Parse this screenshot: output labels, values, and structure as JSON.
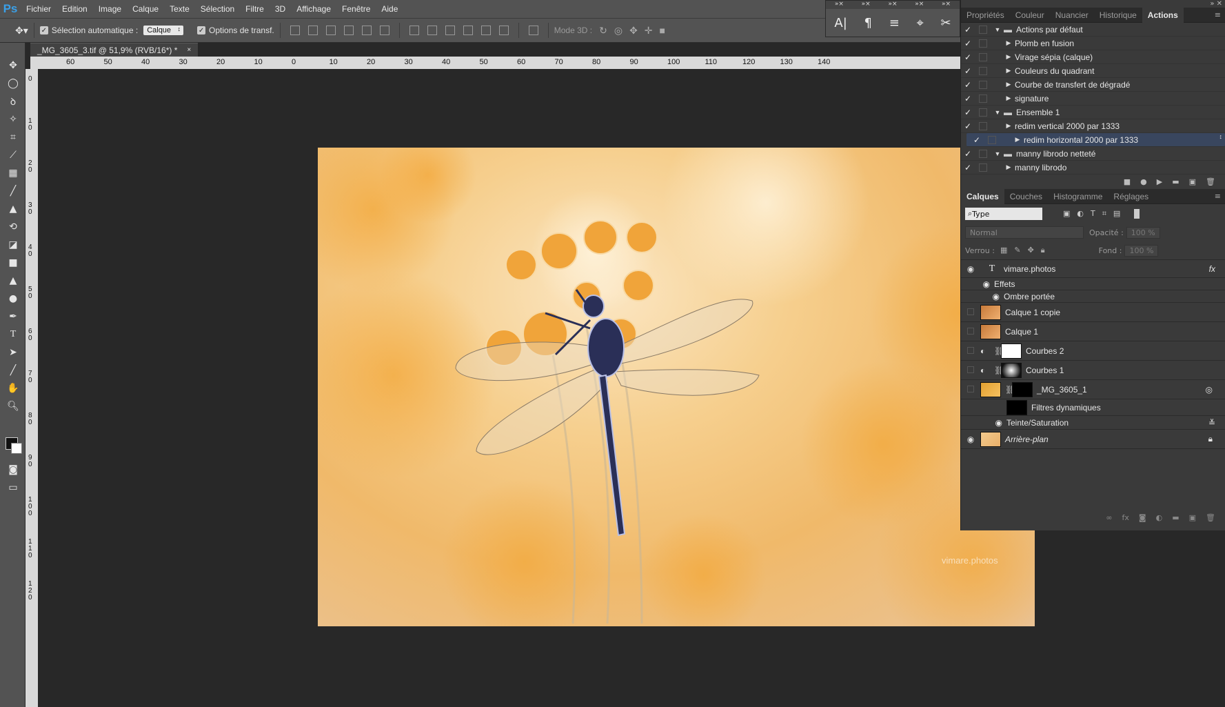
{
  "app": {
    "logo": "Ps"
  },
  "menu": [
    "Fichier",
    "Edition",
    "Image",
    "Calque",
    "Texte",
    "Sélection",
    "Filtre",
    "3D",
    "Affichage",
    "Fenêtre",
    "Aide"
  ],
  "options": {
    "auto_select_label": "Sélection automatique :",
    "auto_select_value": "Calque",
    "transform_label": "Options de transf.",
    "mode3d_label": "Mode 3D :"
  },
  "document": {
    "tab_title": "_MG_3605_3.tif @ 51,9% (RVB/16*) *",
    "close": "×"
  },
  "ruler": {
    "h_ticks": [
      "60",
      "50",
      "40",
      "30",
      "20",
      "10",
      "0",
      "10",
      "20",
      "30",
      "40",
      "50",
      "60",
      "70",
      "80",
      "90",
      "100",
      "110",
      "120",
      "130",
      "140"
    ],
    "v_ticks": [
      "0",
      "1 0",
      "2 0",
      "3 0",
      "4 0",
      "5 0",
      "6 0",
      "7 0",
      "8 0",
      "9 0",
      "1 0 0",
      "1 1 0",
      "1 2 0"
    ]
  },
  "photo": {
    "watermark": "vimare.photos"
  },
  "panels_top": {
    "tabs": [
      "Propriétés",
      "Couleur",
      "Nuancier",
      "Historique",
      "Actions"
    ],
    "active": "Actions"
  },
  "actions": [
    {
      "label": "Actions par défaut",
      "type": "folder",
      "open": true
    },
    {
      "label": "Plomb en fusion",
      "type": "item"
    },
    {
      "label": "Virage sépia (calque)",
      "type": "item"
    },
    {
      "label": "Couleurs du quadrant",
      "type": "item"
    },
    {
      "label": "Courbe de transfert de dégradé",
      "type": "item"
    },
    {
      "label": "signature",
      "type": "item"
    },
    {
      "label": "Ensemble 1",
      "type": "folder",
      "open": true
    },
    {
      "label": "redim vertical 2000 par 1333",
      "type": "item"
    },
    {
      "label": "redim horizontal 2000 par 1333",
      "type": "item",
      "selected": true
    },
    {
      "label": "manny librodo netteté",
      "type": "folder",
      "open": true
    },
    {
      "label": "manny librodo",
      "type": "item"
    }
  ],
  "panels_layers": {
    "tabs": [
      "Calques",
      "Couches",
      "Histogramme",
      "Réglages"
    ],
    "active": "Calques"
  },
  "layers_controls": {
    "filter": "Type",
    "blend": "Normal",
    "opacity_label": "Opacité :",
    "opacity": "100 %",
    "lock_label": "Verrou :",
    "fill_label": "Fond :",
    "fill": "100 %"
  },
  "layers": [
    {
      "name": "vimare.photos",
      "kind": "text",
      "visible": true
    },
    {
      "name": "Effets",
      "kind": "effects-header"
    },
    {
      "name": "Ombre portée",
      "kind": "effect"
    },
    {
      "name": "Calque 1 copie",
      "kind": "pixel",
      "visible": false
    },
    {
      "name": "Calque 1",
      "kind": "pixel",
      "visible": false
    },
    {
      "name": "Courbes 2",
      "kind": "adjust",
      "visible": false
    },
    {
      "name": "Courbes 1",
      "kind": "adjust",
      "visible": false
    },
    {
      "name": "_MG_3605_1",
      "kind": "smart",
      "visible": false
    },
    {
      "name": "Filtres dynamiques",
      "kind": "filter-header"
    },
    {
      "name": "Teinte/Saturation",
      "kind": "filter"
    },
    {
      "name": "Arrière-plan",
      "kind": "background",
      "visible": true
    }
  ]
}
